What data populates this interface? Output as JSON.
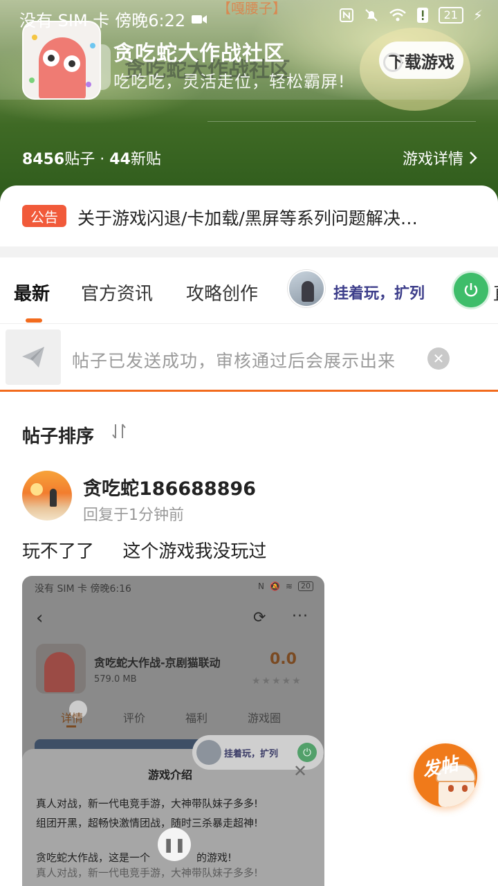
{
  "status_bar": {
    "carrier": "没有 SIM 卡",
    "time": "傍晚6:22",
    "battery": "21"
  },
  "header": {
    "watermark": "【嘎腰子】",
    "title": "贪吃蛇大作战社区",
    "subtitle": "吃吃吃，灵活走位，轻松霸屏!",
    "download_label": "下载游戏",
    "stats_posts_count": "8456",
    "stats_posts_label": "贴子",
    "stats_separator": " · ",
    "stats_new_count": "44",
    "stats_new_label": "新贴",
    "detail_label": "游戏详情"
  },
  "notice": {
    "badge": "公告",
    "text": "关于游戏闪退/卡加载/黑屏等系列问题解决…"
  },
  "tabs": {
    "items": [
      {
        "label": "最新"
      },
      {
        "label": "官方资讯"
      },
      {
        "label": "攻略创作"
      }
    ],
    "active_index": 0,
    "promo_label": "挂着玩，扩列",
    "cut_label": "直"
  },
  "toast": {
    "text": "帖子已发送成功，审核通过后会展示出来"
  },
  "sort": {
    "label": "帖子排序"
  },
  "post": {
    "username": "贪吃蛇186688896",
    "time": "回复于1分钟前",
    "content": "玩不了了     这个游戏我没玩过",
    "screenshot": {
      "status_carrier": "没有 SIM 卡 傍晚6:16",
      "battery": "20",
      "app_title": "贪吃蛇大作战-京剧猫联动",
      "app_size": "579.0 MB",
      "score": "0.0",
      "tabs": [
        "详情",
        "评价",
        "福利",
        "游戏圈"
      ],
      "promo_label": "挂着玩，扩列",
      "panel_title": "游戏介绍",
      "lines": [
        "真人对战，新一代电竞手游，大神带队妹子多多!",
        "组团开黑，超畅快激情团战，随时三杀暴走超神!",
        "贪吃蛇大作战，这是一个",
        "的游戏!",
        "真人对战，新一代电竞手游，大神带队妹子多多!"
      ]
    }
  },
  "fab": {
    "label": "发帖"
  }
}
